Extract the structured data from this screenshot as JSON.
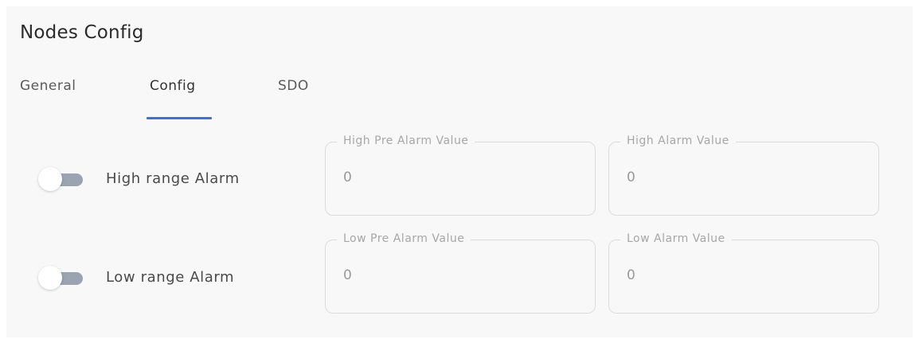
{
  "header": {
    "title": "Nodes Config"
  },
  "tabs": [
    {
      "label": "General"
    },
    {
      "label": "Config"
    },
    {
      "label": "SDO"
    }
  ],
  "active_tab": "Config",
  "accent_color": "#3b6fe6",
  "high_alarm": {
    "toggle_label": "High range Alarm",
    "enabled": false,
    "pre_alarm": {
      "label": "High Pre Alarm Value",
      "value": "0"
    },
    "alarm": {
      "label": "High Alarm Value",
      "value": "0"
    }
  },
  "low_alarm": {
    "toggle_label": "Low range Alarm",
    "enabled": false,
    "pre_alarm": {
      "label": "Low Pre Alarm Value",
      "value": "0"
    },
    "alarm": {
      "label": "Low Alarm Value",
      "value": "0"
    }
  }
}
